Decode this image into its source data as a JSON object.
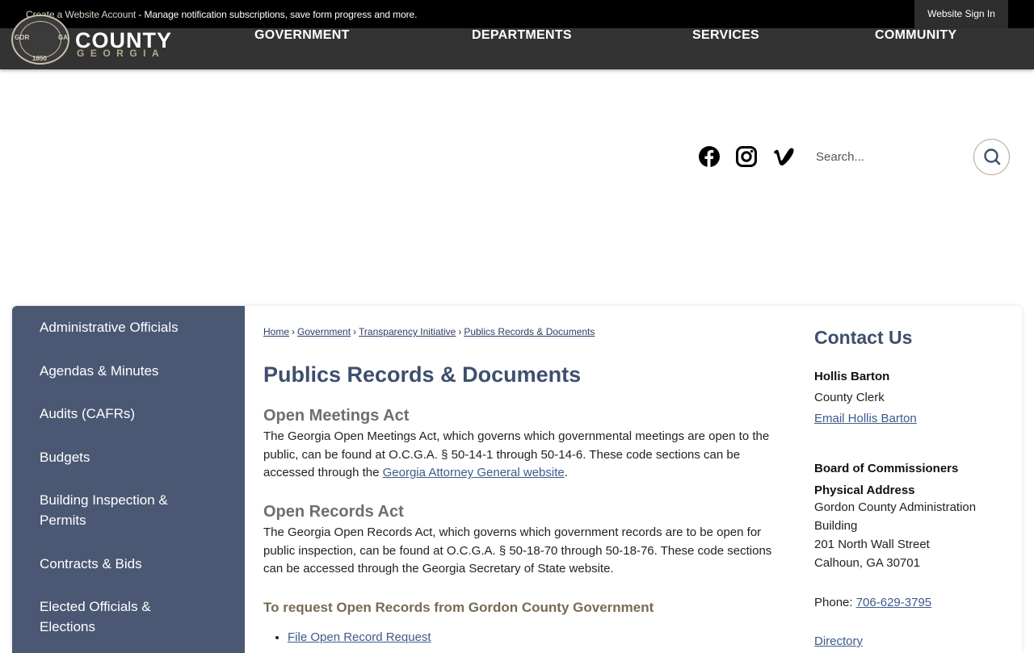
{
  "notice_bar": {
    "create_account": "Create a Website Account",
    "message": " - Manage notification subscriptions, save form progress and more.",
    "sign_in": "Website Sign In"
  },
  "header": {
    "logo_word": "COUNTY",
    "logo_state": "GEORGIA",
    "seal_left": "GOR",
    "seal_right": "GA",
    "seal_year": "1850",
    "nav": [
      "GOVERNMENT",
      "DEPARTMENTS",
      "SERVICES",
      "COMMUNITY"
    ]
  },
  "search": {
    "placeholder": "Search..."
  },
  "social": [
    "facebook-icon",
    "instagram-icon",
    "vimeo-icon"
  ],
  "sidebar": {
    "items": [
      "Administrative Officials",
      "Agendas & Minutes",
      "Audits (CAFRs)",
      "Budgets",
      "Building Inspection & Permits",
      "Contracts & Bids",
      "Elected Officials & Elections"
    ]
  },
  "breadcrumb": [
    "Home",
    "Government",
    "Transparency Initiative",
    "Publics Records & Documents"
  ],
  "main": {
    "title": "Publics Records & Documents",
    "open_meetings": {
      "heading": "Open Meetings Act",
      "text": "The Georgia Open Meetings Act, which governs which governmental meetings are open to the public, can be found at O.C.G.A. § 50-14-1 through 50-14-6. These code sections can be accessed through the ",
      "link": "Georgia Attorney General website",
      "end": "."
    },
    "open_records": {
      "heading": "Open Records Act",
      "text": "The Georgia Open Records Act, which governs which government records are to be open for public inspection, can be found at O.C.G.A. § 50-18-70 through 50-18-76. These code sections can be accessed through the Georgia Secretary of State website."
    },
    "request_heading": "To request Open Records from Gordon County Government",
    "request_links": [
      "File Open Record Request"
    ]
  },
  "contact": {
    "title": "Contact Us",
    "name": "Hollis Barton",
    "role": "County Clerk",
    "email_link": "Email Hollis Barton",
    "org": "Board of Commissioners",
    "address_label": "Physical Address",
    "address_line1": "Gordon County Administration",
    "address_line2": "Building",
    "address_line3": "201 North Wall Street",
    "address_line4": "Calhoun, GA 30701",
    "phone_label": "Phone: ",
    "phone": "706-629-3795",
    "directory": "Directory"
  },
  "colors": {
    "sidebar": "#4a5873",
    "header": "#333333",
    "title": "#3d4f6e",
    "accent": "#b5a98f"
  }
}
